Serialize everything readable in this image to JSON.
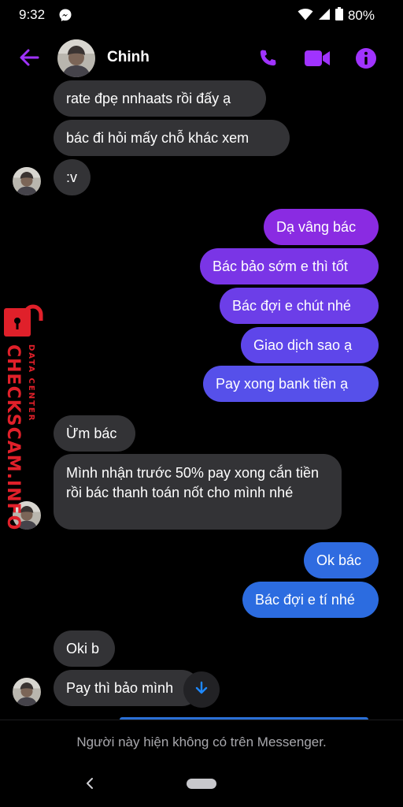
{
  "status_bar": {
    "time": "9:32",
    "battery": "80%",
    "icons": [
      "messenger-icon",
      "wifi-icon",
      "signal-icon",
      "battery-icon"
    ]
  },
  "header": {
    "contact_name": "Chinh",
    "icons": [
      "back-arrow-icon",
      "phone-icon",
      "video-camera-icon",
      "info-icon"
    ],
    "accent_color": "#a033ff"
  },
  "messages": [
    {
      "side": "in",
      "text": "rate đpẹ nnhaats rồi đấy ạ"
    },
    {
      "side": "in",
      "text": "bác đi hỏi mấy chỗ khác xem"
    },
    {
      "side": "in",
      "text": ":v"
    },
    {
      "side": "out",
      "text": "Dạ vâng bác",
      "color": "#8a2be2"
    },
    {
      "side": "out",
      "text": "Bác bảo sớm e thì tốt",
      "color": "#7a35e6"
    },
    {
      "side": "out",
      "text": "Bác đợi e chút nhé",
      "color": "#6c3ee8"
    },
    {
      "side": "out",
      "text": "Giao dịch sao ạ",
      "color": "#5e46ea"
    },
    {
      "side": "out",
      "text": "Pay xong bank tiền ạ",
      "color": "#5650ea"
    },
    {
      "side": "in",
      "text": "Ừm bác"
    },
    {
      "side": "in",
      "text": "Mình nhận trước 50% pay xong cắn tiền rồi bác thanh toán nốt cho mình nhé"
    },
    {
      "side": "out",
      "text": "Ok bác",
      "color": "#2f6be0"
    },
    {
      "side": "out",
      "text": "Bác đợi e tí nhé",
      "color": "#2c6ce0"
    },
    {
      "side": "in",
      "text": "Oki b"
    },
    {
      "side": "in",
      "text": "Pay thì bảo mình"
    }
  ],
  "watermark": {
    "brand": "CHECKSCAM.INFO",
    "tagline": "DATA CENTER"
  },
  "footer": {
    "unavailable_notice": "Người này hiện không có trên Messenger."
  },
  "colors": {
    "incoming_bubble": "#333336",
    "watermark_red": "#e0202a"
  }
}
